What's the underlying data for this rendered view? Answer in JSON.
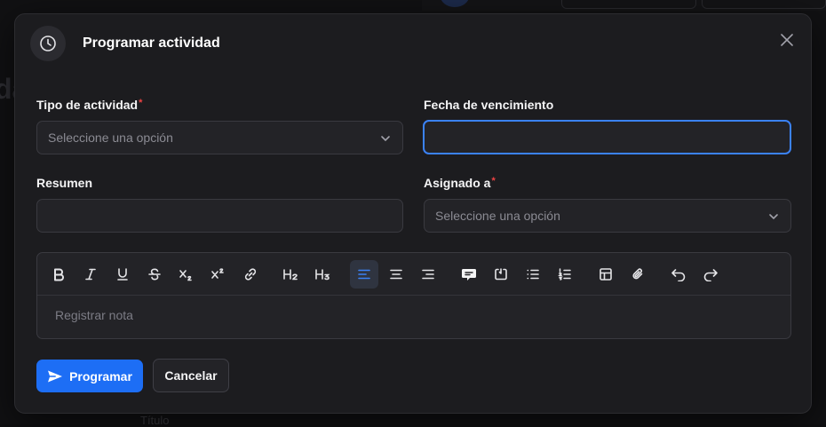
{
  "background": {
    "fragment_text": "da",
    "fragment_label": "Título"
  },
  "modal": {
    "title": "Programar actividad",
    "header_icon": "clock-icon",
    "close_icon": "close-icon"
  },
  "form": {
    "activity_type": {
      "label": "Tipo de actividad",
      "required": "*",
      "placeholder": "Seleccione una opción"
    },
    "due_date": {
      "label": "Fecha de vencimiento",
      "value": ""
    },
    "summary": {
      "label": "Resumen",
      "value": ""
    },
    "assigned_to": {
      "label": "Asignado a",
      "required": "*",
      "placeholder": "Seleccione una opción"
    },
    "note": {
      "placeholder": "Registrar nota"
    }
  },
  "toolbar": {
    "items": [
      "bold-icon",
      "italic-icon",
      "underline-icon",
      "strikethrough-icon",
      "subscript-icon",
      "superscript-icon",
      "link-icon",
      "heading-2-icon",
      "heading-3-icon",
      "align-left-icon",
      "align-center-icon",
      "align-right-icon",
      "blockquote-icon",
      "code-block-icon",
      "bullet-list-icon",
      "ordered-list-icon",
      "table-icon",
      "attach-icon",
      "undo-icon",
      "redo-icon"
    ],
    "active": "align-left-icon"
  },
  "actions": {
    "submit_label": "Programar",
    "cancel_label": "Cancelar"
  },
  "colors": {
    "accent": "#1d6ef5",
    "focus": "#3b82f6",
    "required": "#ef4444",
    "surface": "#1c1c1f"
  }
}
